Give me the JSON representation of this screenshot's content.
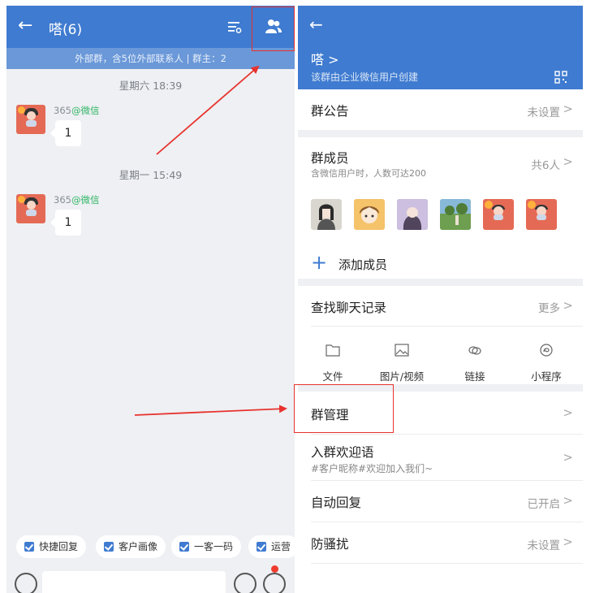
{
  "left": {
    "header": {
      "back_glyph": "←",
      "title": "嗒(6)"
    },
    "subheader": "外部群，含5位外部联系人 | 群主：2",
    "messages": [
      {
        "time": "星期六 18:39",
        "sender_name": "365",
        "sender_tag": "@微信",
        "text": "1"
      },
      {
        "time": "星期一 15:49",
        "sender_name": "365",
        "sender_tag": "@微信",
        "text": "1"
      }
    ],
    "quick_actions": [
      "快捷回复",
      "客户画像",
      "一客一码",
      "运营"
    ]
  },
  "right": {
    "header": {
      "back_glyph": "←",
      "group_name": "嗒 >",
      "desc": "该群由企业微信用户创建"
    },
    "announcement": {
      "title": "群公告",
      "value": "未设置"
    },
    "members": {
      "title": "群成员",
      "sub": "含微信用户时，人数可达200",
      "value": "共6人",
      "add_label": "添加成员"
    },
    "search": {
      "title": "查找聊天记录",
      "value": "更多"
    },
    "file_types": [
      {
        "label": "文件",
        "icon": "folder-icon"
      },
      {
        "label": "图片/视频",
        "icon": "image-icon"
      },
      {
        "label": "链接",
        "icon": "link-icon"
      },
      {
        "label": "小程序",
        "icon": "mini-program-icon"
      }
    ],
    "management": {
      "title": "群管理"
    },
    "welcome": {
      "title": "入群欢迎语",
      "sub": "#客户昵称#欢迎加入我们~"
    },
    "auto_reply": {
      "title": "自动回复",
      "value": "已开启"
    },
    "anti_spam": {
      "title": "防骚扰",
      "value": "未设置"
    },
    "chevron": ">"
  },
  "colors": {
    "brand_blue": "#3f7bd0",
    "annotation_red": "#e8322d",
    "sender_green": "#2fb564"
  }
}
